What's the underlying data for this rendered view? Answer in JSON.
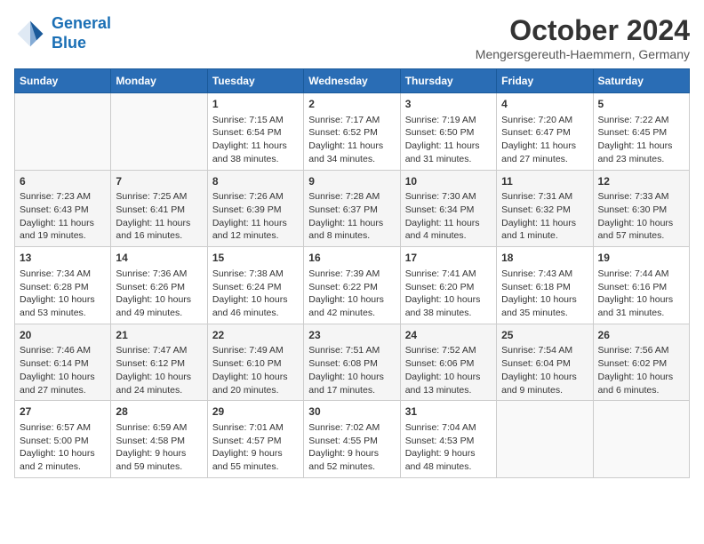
{
  "header": {
    "logo_line1": "General",
    "logo_line2": "Blue",
    "month_title": "October 2024",
    "location": "Mengersgereuth-Haemmern, Germany"
  },
  "days_of_week": [
    "Sunday",
    "Monday",
    "Tuesday",
    "Wednesday",
    "Thursday",
    "Friday",
    "Saturday"
  ],
  "weeks": [
    [
      {
        "day": "",
        "content": ""
      },
      {
        "day": "",
        "content": ""
      },
      {
        "day": "1",
        "content": "Sunrise: 7:15 AM\nSunset: 6:54 PM\nDaylight: 11 hours and 38 minutes."
      },
      {
        "day": "2",
        "content": "Sunrise: 7:17 AM\nSunset: 6:52 PM\nDaylight: 11 hours and 34 minutes."
      },
      {
        "day": "3",
        "content": "Sunrise: 7:19 AM\nSunset: 6:50 PM\nDaylight: 11 hours and 31 minutes."
      },
      {
        "day": "4",
        "content": "Sunrise: 7:20 AM\nSunset: 6:47 PM\nDaylight: 11 hours and 27 minutes."
      },
      {
        "day": "5",
        "content": "Sunrise: 7:22 AM\nSunset: 6:45 PM\nDaylight: 11 hours and 23 minutes."
      }
    ],
    [
      {
        "day": "6",
        "content": "Sunrise: 7:23 AM\nSunset: 6:43 PM\nDaylight: 11 hours and 19 minutes."
      },
      {
        "day": "7",
        "content": "Sunrise: 7:25 AM\nSunset: 6:41 PM\nDaylight: 11 hours and 16 minutes."
      },
      {
        "day": "8",
        "content": "Sunrise: 7:26 AM\nSunset: 6:39 PM\nDaylight: 11 hours and 12 minutes."
      },
      {
        "day": "9",
        "content": "Sunrise: 7:28 AM\nSunset: 6:37 PM\nDaylight: 11 hours and 8 minutes."
      },
      {
        "day": "10",
        "content": "Sunrise: 7:30 AM\nSunset: 6:34 PM\nDaylight: 11 hours and 4 minutes."
      },
      {
        "day": "11",
        "content": "Sunrise: 7:31 AM\nSunset: 6:32 PM\nDaylight: 11 hours and 1 minute."
      },
      {
        "day": "12",
        "content": "Sunrise: 7:33 AM\nSunset: 6:30 PM\nDaylight: 10 hours and 57 minutes."
      }
    ],
    [
      {
        "day": "13",
        "content": "Sunrise: 7:34 AM\nSunset: 6:28 PM\nDaylight: 10 hours and 53 minutes."
      },
      {
        "day": "14",
        "content": "Sunrise: 7:36 AM\nSunset: 6:26 PM\nDaylight: 10 hours and 49 minutes."
      },
      {
        "day": "15",
        "content": "Sunrise: 7:38 AM\nSunset: 6:24 PM\nDaylight: 10 hours and 46 minutes."
      },
      {
        "day": "16",
        "content": "Sunrise: 7:39 AM\nSunset: 6:22 PM\nDaylight: 10 hours and 42 minutes."
      },
      {
        "day": "17",
        "content": "Sunrise: 7:41 AM\nSunset: 6:20 PM\nDaylight: 10 hours and 38 minutes."
      },
      {
        "day": "18",
        "content": "Sunrise: 7:43 AM\nSunset: 6:18 PM\nDaylight: 10 hours and 35 minutes."
      },
      {
        "day": "19",
        "content": "Sunrise: 7:44 AM\nSunset: 6:16 PM\nDaylight: 10 hours and 31 minutes."
      }
    ],
    [
      {
        "day": "20",
        "content": "Sunrise: 7:46 AM\nSunset: 6:14 PM\nDaylight: 10 hours and 27 minutes."
      },
      {
        "day": "21",
        "content": "Sunrise: 7:47 AM\nSunset: 6:12 PM\nDaylight: 10 hours and 24 minutes."
      },
      {
        "day": "22",
        "content": "Sunrise: 7:49 AM\nSunset: 6:10 PM\nDaylight: 10 hours and 20 minutes."
      },
      {
        "day": "23",
        "content": "Sunrise: 7:51 AM\nSunset: 6:08 PM\nDaylight: 10 hours and 17 minutes."
      },
      {
        "day": "24",
        "content": "Sunrise: 7:52 AM\nSunset: 6:06 PM\nDaylight: 10 hours and 13 minutes."
      },
      {
        "day": "25",
        "content": "Sunrise: 7:54 AM\nSunset: 6:04 PM\nDaylight: 10 hours and 9 minutes."
      },
      {
        "day": "26",
        "content": "Sunrise: 7:56 AM\nSunset: 6:02 PM\nDaylight: 10 hours and 6 minutes."
      }
    ],
    [
      {
        "day": "27",
        "content": "Sunrise: 6:57 AM\nSunset: 5:00 PM\nDaylight: 10 hours and 2 minutes."
      },
      {
        "day": "28",
        "content": "Sunrise: 6:59 AM\nSunset: 4:58 PM\nDaylight: 9 hours and 59 minutes."
      },
      {
        "day": "29",
        "content": "Sunrise: 7:01 AM\nSunset: 4:57 PM\nDaylight: 9 hours and 55 minutes."
      },
      {
        "day": "30",
        "content": "Sunrise: 7:02 AM\nSunset: 4:55 PM\nDaylight: 9 hours and 52 minutes."
      },
      {
        "day": "31",
        "content": "Sunrise: 7:04 AM\nSunset: 4:53 PM\nDaylight: 9 hours and 48 minutes."
      },
      {
        "day": "",
        "content": ""
      },
      {
        "day": "",
        "content": ""
      }
    ]
  ]
}
